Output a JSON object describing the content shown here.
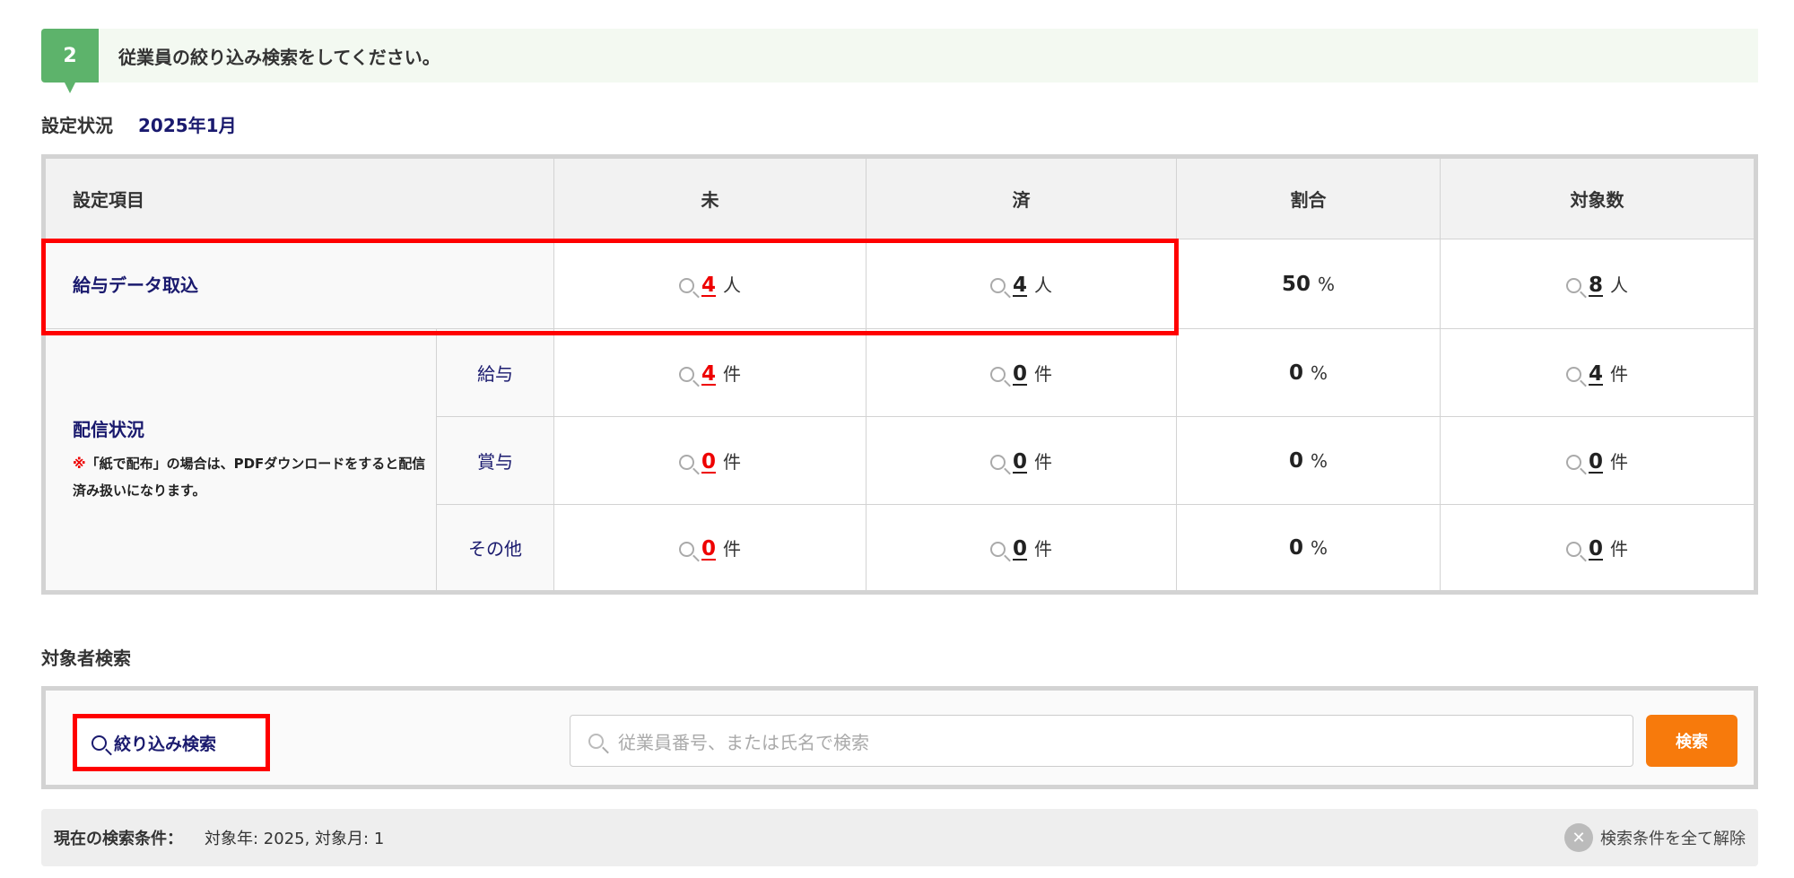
{
  "banner": {
    "step": "2",
    "text": "従業員の絞り込み検索をしてください。"
  },
  "status": {
    "label": "設定状況",
    "period": "2025年1月"
  },
  "table": {
    "headers": [
      "設定項目",
      "未",
      "済",
      "割合",
      "対象数"
    ],
    "import_row": {
      "label": "給与データ取込",
      "pending": "4",
      "pending_unit": "人",
      "done": "4",
      "done_unit": "人",
      "ratio": "50",
      "ratio_unit": "%",
      "total": "8",
      "total_unit": "人"
    },
    "delivery": {
      "label": "配信状況",
      "note_mark": "※",
      "note": "「紙で配布」の場合は、PDFダウンロードをすると配信済み扱いになります。",
      "rows": [
        {
          "label": "給与",
          "pending": "4",
          "done": "0",
          "ratio": "0",
          "total": "4",
          "unit": "件",
          "pct": "%"
        },
        {
          "label": "賞与",
          "pending": "0",
          "done": "0",
          "ratio": "0",
          "total": "0",
          "unit": "件",
          "pct": "%"
        },
        {
          "label": "その他",
          "pending": "0",
          "done": "0",
          "ratio": "0",
          "total": "0",
          "unit": "件",
          "pct": "%"
        }
      ]
    }
  },
  "search": {
    "title": "対象者検索",
    "filter_label": "絞り込み検索",
    "placeholder": "従業員番号、または氏名で検索",
    "button": "検索"
  },
  "conditions": {
    "label": "現在の検索条件：",
    "value": "対象年: 2025, 対象月: 1",
    "clear": "検索条件を全て解除"
  }
}
